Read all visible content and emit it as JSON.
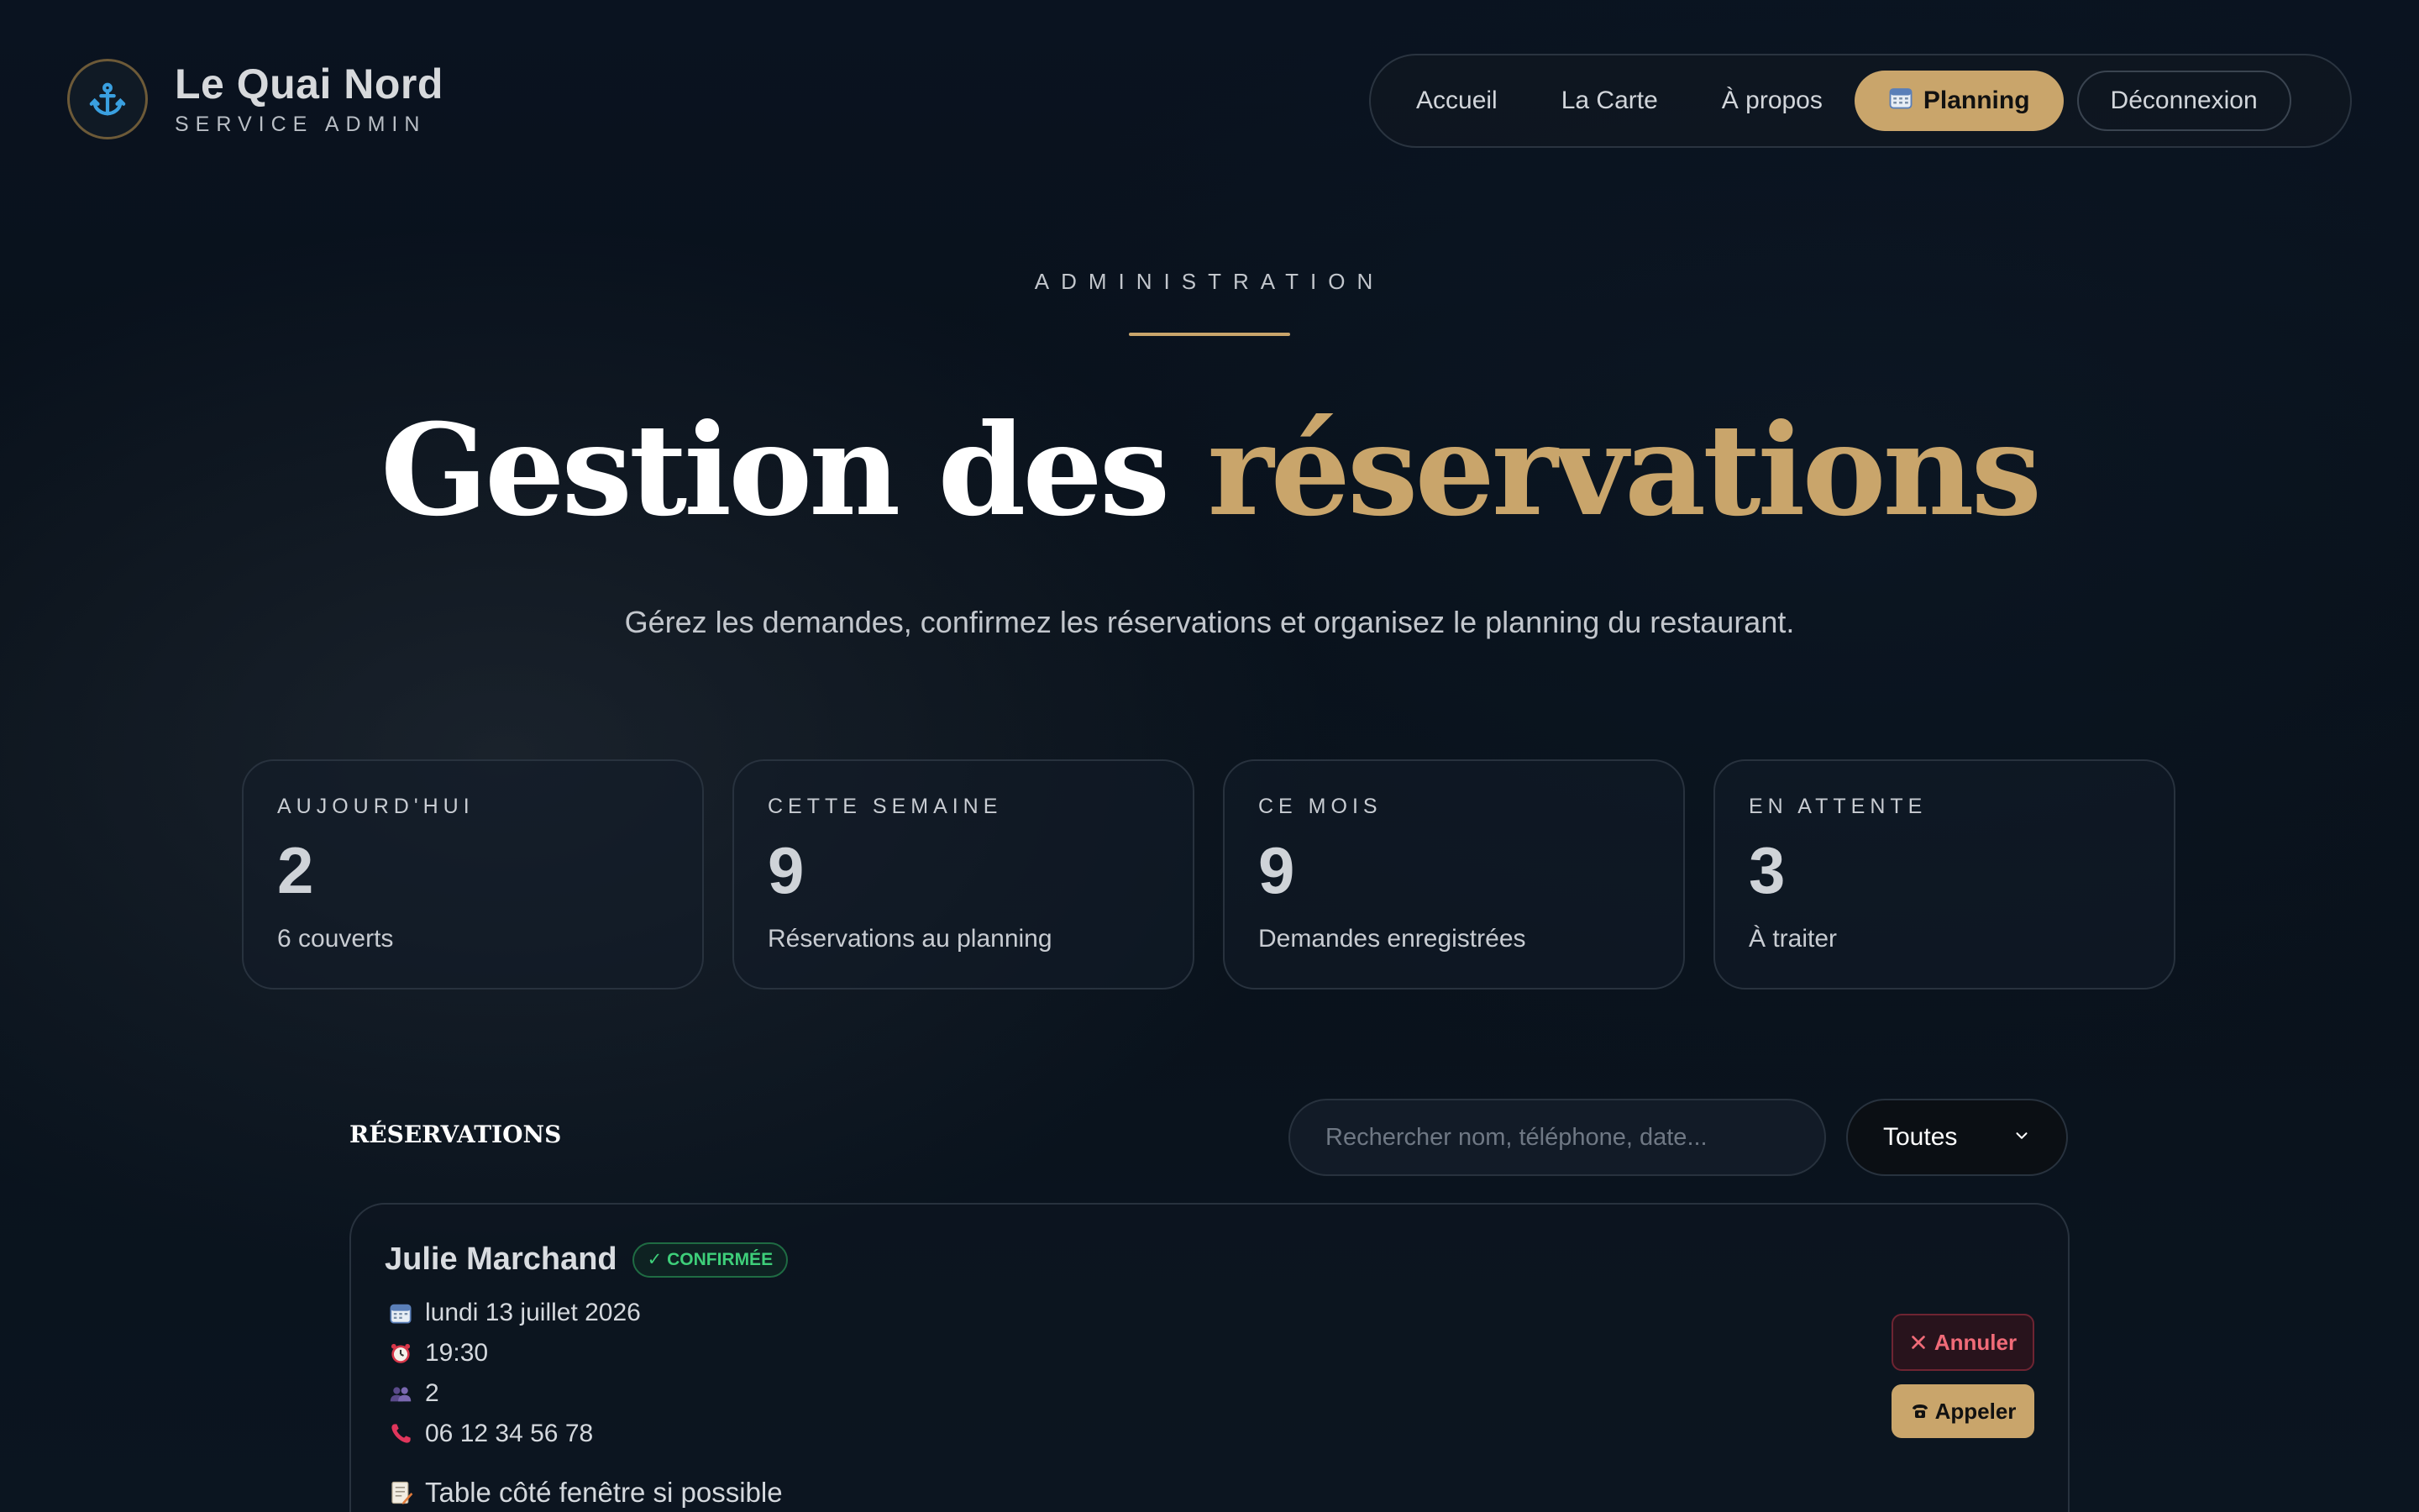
{
  "brand": {
    "name": "Le Quai Nord",
    "subtitle": "SERVICE ADMIN",
    "logo_icon": "anchor-icon"
  },
  "nav": {
    "items": [
      {
        "label": "Accueil"
      },
      {
        "label": "La Carte"
      },
      {
        "label": "À propos"
      },
      {
        "label": "Planning",
        "icon": "calendar-icon",
        "active": true
      },
      {
        "label": "Déconnexion"
      }
    ]
  },
  "hero": {
    "eyebrow": "ADMINISTRATION",
    "title_main": "Gestion des",
    "title_accent": "réservations",
    "subtitle": "Gérez les demandes, confirmez les réservations et organisez le planning du restaurant."
  },
  "stats": [
    {
      "label": "AUJOURD'HUI",
      "value": "2",
      "desc": "6 couverts"
    },
    {
      "label": "CETTE SEMAINE",
      "value": "9",
      "desc": "Réservations au planning"
    },
    {
      "label": "CE MOIS",
      "value": "9",
      "desc": "Demandes enregistrées"
    },
    {
      "label": "EN ATTENTE",
      "value": "3",
      "desc": "À traiter"
    }
  ],
  "reservations": {
    "title": "RÉSERVATIONS",
    "search_placeholder": "Rechercher nom, téléphone, date...",
    "filter_value": "Toutes",
    "items": [
      {
        "name": "Julie Marchand",
        "status": "✓ CONFIRMÉE",
        "date": "lundi 13 juillet 2026",
        "time": "19:30",
        "guests": "2",
        "phone": "06 12 34 56 78",
        "note": "Table côté fenêtre si possible",
        "cancel_label": "Annuler",
        "call_label": "Appeler"
      }
    ]
  },
  "colors": {
    "accent": "#c9a56b",
    "background": "#07101b",
    "success": "#3ecf7a",
    "danger": "#f06b78"
  }
}
